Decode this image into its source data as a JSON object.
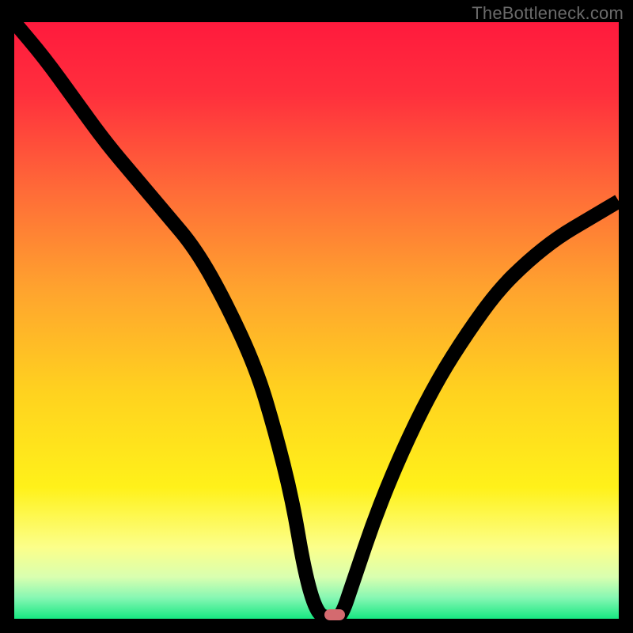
{
  "watermark": "TheBottleneck.com",
  "colors": {
    "gradient_stops": [
      {
        "offset": 0.0,
        "color": "#ff1a3d"
      },
      {
        "offset": 0.12,
        "color": "#ff2f3d"
      },
      {
        "offset": 0.28,
        "color": "#ff6a38"
      },
      {
        "offset": 0.45,
        "color": "#ffa42e"
      },
      {
        "offset": 0.62,
        "color": "#ffd21f"
      },
      {
        "offset": 0.78,
        "color": "#fff11a"
      },
      {
        "offset": 0.88,
        "color": "#fcff8a"
      },
      {
        "offset": 0.93,
        "color": "#d9ffb0"
      },
      {
        "offset": 0.965,
        "color": "#86f7b3"
      },
      {
        "offset": 1.0,
        "color": "#17e882"
      }
    ],
    "marker_fill": "#d46a6f",
    "background": "#000000"
  },
  "chart_data": {
    "type": "line",
    "title": "",
    "xlabel": "",
    "ylabel": "",
    "xlim": [
      0,
      100
    ],
    "ylim": [
      0,
      100
    ],
    "grid": false,
    "legend": false,
    "series": [
      {
        "name": "bottleneck-curve",
        "x": [
          0,
          5,
          10,
          15,
          20,
          25,
          30,
          35,
          40,
          43,
          46,
          48,
          50,
          52,
          54,
          56,
          60,
          65,
          70,
          75,
          80,
          85,
          90,
          95,
          100
        ],
        "values": [
          100,
          94,
          87,
          80,
          74,
          68,
          62,
          53,
          42,
          32,
          20,
          8,
          1,
          0,
          0,
          6,
          18,
          30,
          40,
          48,
          55,
          60,
          64,
          67,
          70
        ]
      }
    ],
    "annotations": [
      {
        "name": "minimum-marker",
        "x": 53,
        "y": 0.6
      }
    ]
  }
}
